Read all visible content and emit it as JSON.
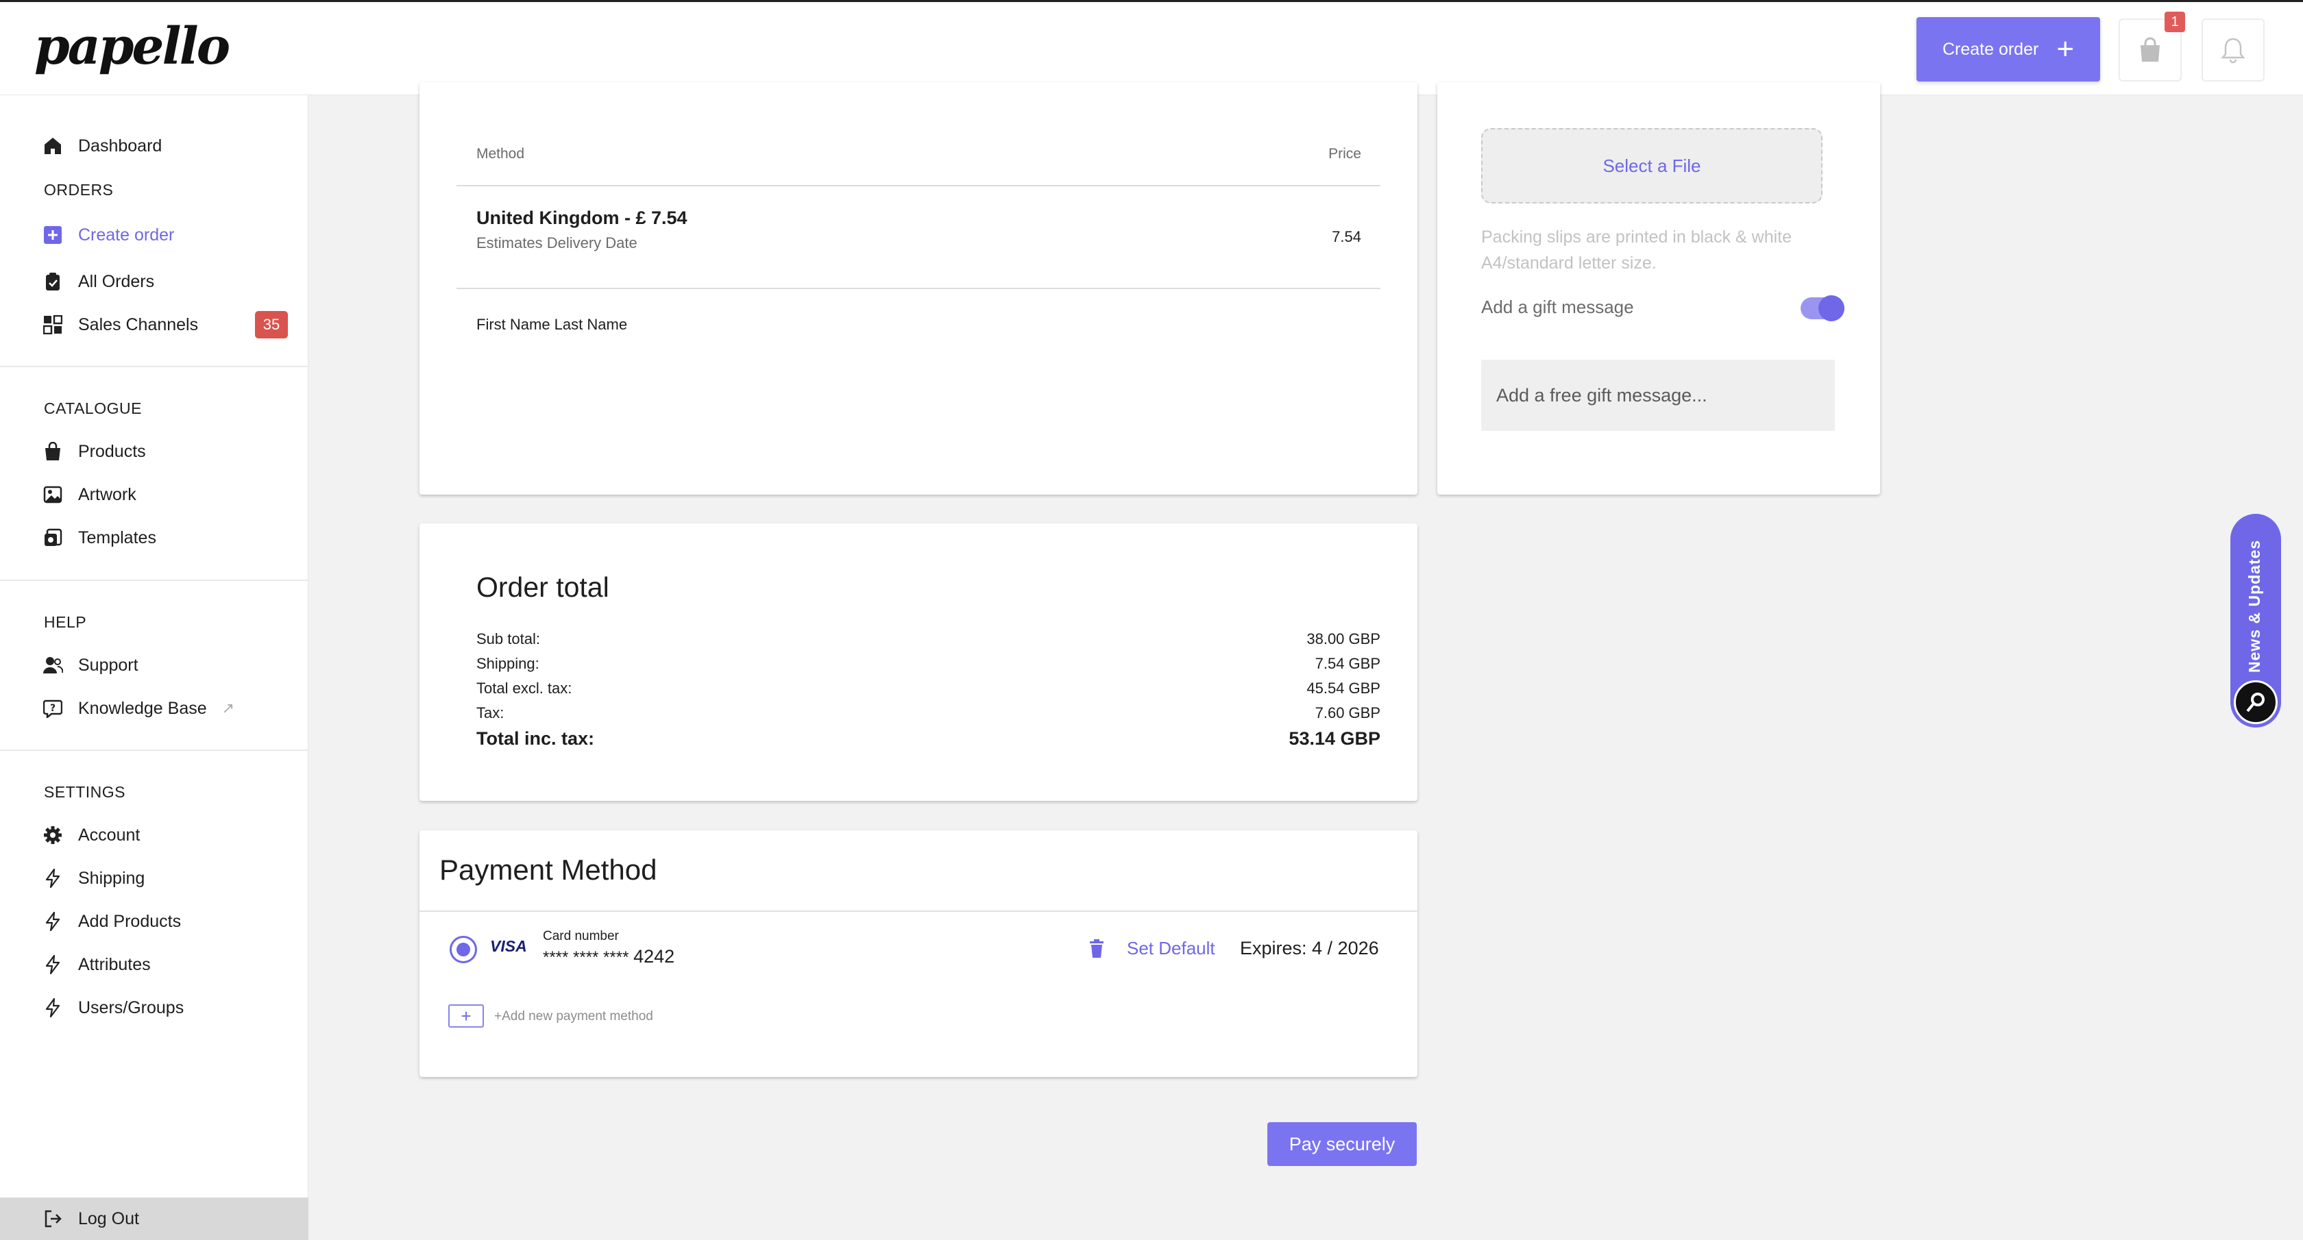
{
  "app": {
    "logo": "papello"
  },
  "header": {
    "create_order_label": "Create order",
    "cart_count": "1"
  },
  "sidebar": {
    "dashboard": "Dashboard",
    "orders_section": "ORDERS",
    "create_order": "Create order",
    "all_orders": "All Orders",
    "sales_channels": "Sales Channels",
    "sales_channels_count": "35",
    "catalogue_section": "CATALOGUE",
    "products": "Products",
    "artwork": "Artwork",
    "templates": "Templates",
    "help_section": "HELP",
    "support": "Support",
    "knowledge_base": "Knowledge Base",
    "settings_section": "SETTINGS",
    "account": "Account",
    "shipping": "Shipping",
    "add_products": "Add Products",
    "attributes": "Attributes",
    "users_groups": "Users/Groups",
    "log_out": "Log Out"
  },
  "shipping_card": {
    "col_method": "Method",
    "col_price": "Price",
    "option_title": "United Kingdom - £ 7.54",
    "option_sub": "Estimates Delivery Date",
    "option_price": "7.54",
    "recipient": "First Name Last Name"
  },
  "gift_card": {
    "select_file": "Select a File",
    "packing_note": "Packing slips are printed in black & white A4/standard letter size.",
    "gift_toggle_label": "Add a gift message",
    "gift_toggle_on": true,
    "gift_placeholder": "Add a free gift message..."
  },
  "order_total": {
    "title": "Order total",
    "rows": [
      {
        "label": "Sub total:",
        "value": "38.00 GBP"
      },
      {
        "label": "Shipping:",
        "value": "7.54 GBP"
      },
      {
        "label": "Total excl. tax:",
        "value": "45.54 GBP"
      },
      {
        "label": "Tax:",
        "value": "7.60 GBP"
      }
    ],
    "total_label": "Total inc. tax:",
    "total_value": "53.14 GBP"
  },
  "payment": {
    "title": "Payment Method",
    "card_brand": "VISA",
    "card_number_label": "Card number",
    "card_mask": "**** **** ****",
    "card_last4": "4242",
    "set_default": "Set Default",
    "expires": "Expires: 4 / 2026",
    "add_new": "+Add new payment method"
  },
  "pay_button": "Pay securely",
  "news_tab": "News & Updates",
  "colors": {
    "accent": "#7b74f0",
    "accent_dark": "#6f67e8",
    "danger": "#d9534f",
    "background": "#f2f2f2"
  }
}
